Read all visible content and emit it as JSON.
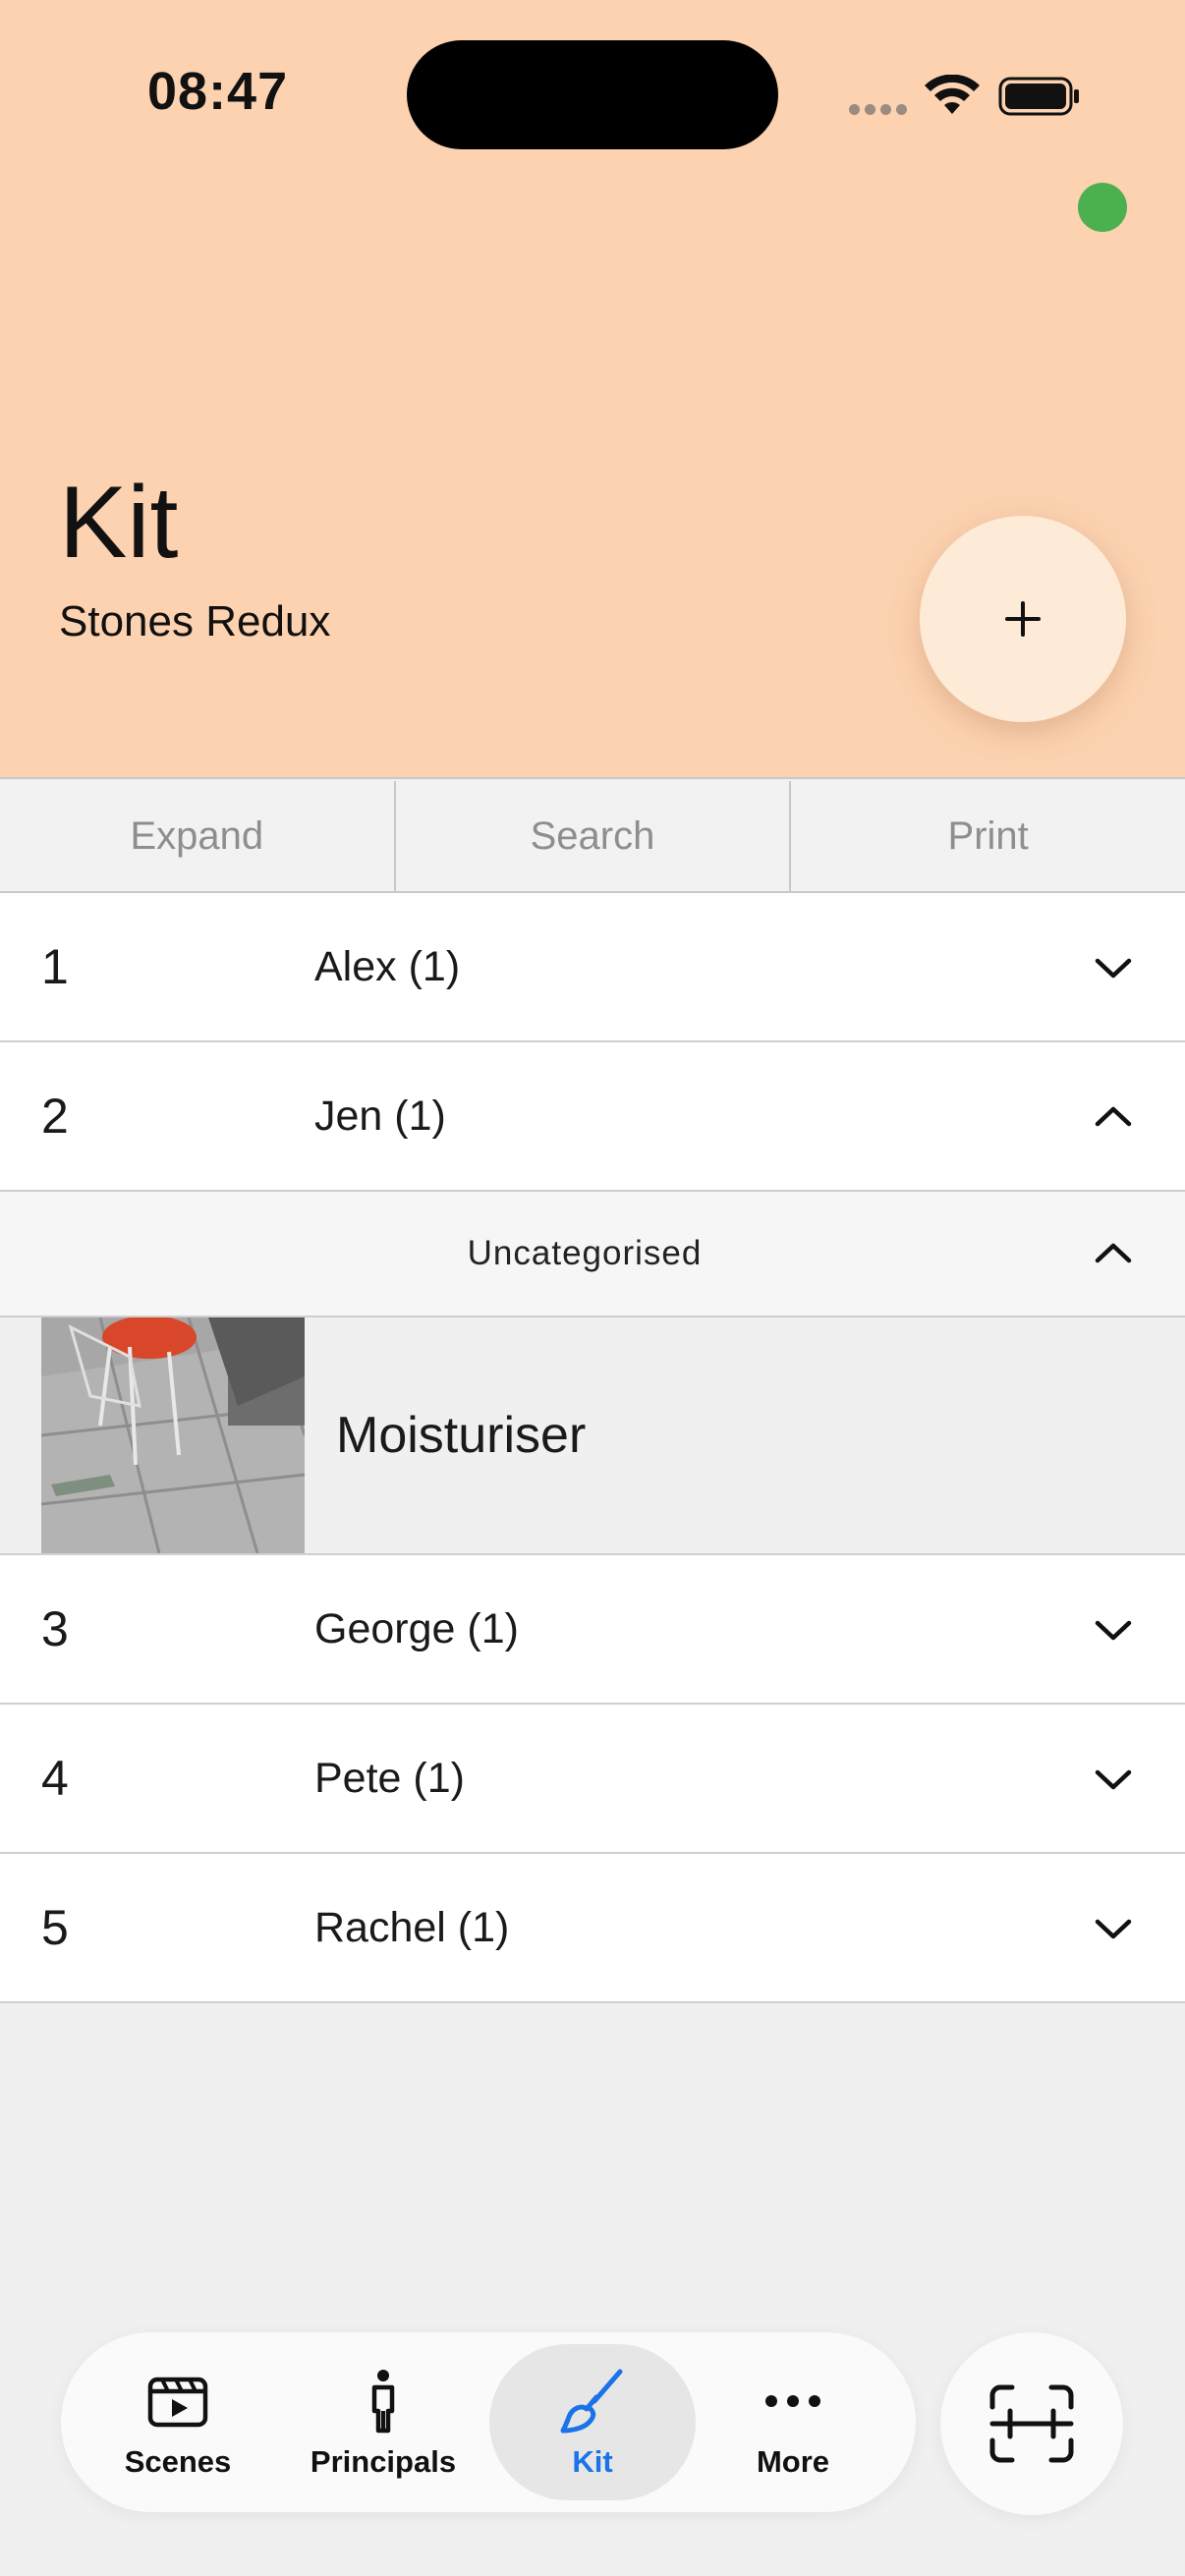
{
  "status_bar": {
    "time": "08:47"
  },
  "header": {
    "title": "Kit",
    "subtitle": "Stones Redux",
    "indicator_color": "#4caf50",
    "background_color": "#fcd2b0"
  },
  "toolbar": {
    "buttons": [
      {
        "label": "Expand"
      },
      {
        "label": "Search"
      },
      {
        "label": "Print"
      }
    ]
  },
  "principals": [
    {
      "number": "1",
      "name": "Alex (1)",
      "expanded": false
    },
    {
      "number": "2",
      "name": "Jen (1)",
      "expanded": true,
      "category": "Uncategorised",
      "items": [
        {
          "name": "Moisturiser"
        }
      ]
    },
    {
      "number": "3",
      "name": "George (1)",
      "expanded": false
    },
    {
      "number": "4",
      "name": "Pete (1)",
      "expanded": false
    },
    {
      "number": "5",
      "name": "Rachel (1)",
      "expanded": false
    }
  ],
  "tabbar": {
    "tabs": [
      {
        "label": "Scenes",
        "icon": "clapperboard-icon",
        "active": false
      },
      {
        "label": "Principals",
        "icon": "person-icon",
        "active": false
      },
      {
        "label": "Kit",
        "icon": "makeup-brush-icon",
        "active": true
      },
      {
        "label": "More",
        "icon": "ellipsis-icon",
        "active": false
      }
    ],
    "active_color": "#1a73e8",
    "scan_icon": "scan-icon"
  }
}
